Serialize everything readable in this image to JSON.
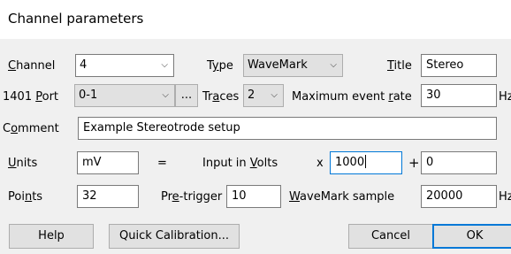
{
  "window": {
    "title": "Channel parameters"
  },
  "channel": {
    "label_pre": "",
    "label_u": "C",
    "label_post": "hannel",
    "value": "4"
  },
  "type": {
    "label_pre": "T",
    "label_u": "y",
    "label_post": "pe",
    "value": "WaveMark"
  },
  "title_field": {
    "label_pre": "",
    "label_u": "T",
    "label_post": "itle",
    "value": "Stereo"
  },
  "port": {
    "label_pre": "1401 ",
    "label_u": "P",
    "label_post": "ort",
    "value": "0-1",
    "browse_label": "..."
  },
  "traces": {
    "label_pre": "Tr",
    "label_u": "a",
    "label_post": "ces",
    "value": "2"
  },
  "max_rate": {
    "label_pre": "Maximum event ",
    "label_u": "r",
    "label_post": "ate",
    "value": "30",
    "unit": "Hz"
  },
  "comment": {
    "label_pre": "C",
    "label_u": "o",
    "label_post": "mment",
    "value": "Example Stereotrode setup"
  },
  "units": {
    "label_pre": "",
    "label_u": "U",
    "label_post": "nits",
    "value": "mV"
  },
  "equals": "=",
  "input_volts": {
    "label_pre": "Input in ",
    "label_u": "V",
    "label_post": "olts"
  },
  "times": "x",
  "scale": {
    "value": "1000"
  },
  "plus": "+",
  "offset": {
    "value": "0"
  },
  "points": {
    "label_pre": "Poi",
    "label_u": "n",
    "label_post": "ts",
    "value": "32"
  },
  "pretrigger": {
    "label_pre": "Pr",
    "label_u": "e",
    "label_post": "-trigger",
    "value": "10"
  },
  "wavemark_sample": {
    "label_pre": "",
    "label_u": "W",
    "label_post": "aveMark sample",
    "value": "20000",
    "unit": "Hz"
  },
  "buttons": {
    "help": "Help",
    "quick_cal": "Quick Calibration...",
    "cancel": "Cancel",
    "ok": "OK"
  },
  "icons": {
    "dropdown": "chevron-down-icon"
  },
  "colors": {
    "focus": "#0078d7",
    "dialog_bg": "#f0f0f0"
  }
}
